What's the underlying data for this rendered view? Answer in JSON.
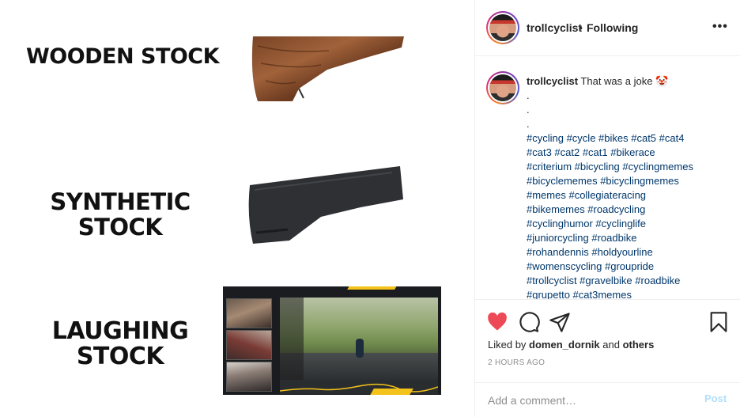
{
  "meme": {
    "label_wooden": "WOODEN STOCK",
    "label_synthetic_1": "SYNTHETIC",
    "label_synthetic_2": "STOCK",
    "label_laughing_1": "LAUGHING",
    "label_laughing_2": "STOCK"
  },
  "header": {
    "username": "trollcyclist",
    "separator": "•",
    "follow_status": "Following",
    "more_glyph": "•••"
  },
  "caption": {
    "username": "trollcyclist",
    "text": "That was a joke 🤡",
    "dots": [
      ".",
      ".",
      "."
    ],
    "hashtag_lines": [
      "#cycling #cycle #bikes #cat5  #cat4",
      "#cat3 #cat2 #cat1 #bikerace",
      "#criterium #bicycling #cyclingmemes",
      "#bicyclememes #bicyclingmemes",
      "#memes #collegiateracing",
      "#bikememes #roadcycling",
      "#cyclinghumor #cyclinglife",
      "#juniorcycling #roadbike",
      "#rohandennis #holdyourline",
      "#womenscycling #groupride",
      "#trollcyclist #gravelbike #roadbike",
      "#grupetto #cat3memes"
    ]
  },
  "actions": {
    "liked_by_prefix": "Liked by",
    "liked_by_user": "domen_dornik",
    "liked_by_and": "and",
    "liked_by_others": "others",
    "timestamp": "2 HOURS AGO",
    "like_color": "#ed4956"
  },
  "comment_box": {
    "placeholder": "Add a comment…",
    "post_label": "Post",
    "post_color": "#b2dffc"
  },
  "colors": {
    "hashtag": "#00376b",
    "text": "#262626",
    "muted": "#8e8e8e",
    "border": "#efefef"
  }
}
